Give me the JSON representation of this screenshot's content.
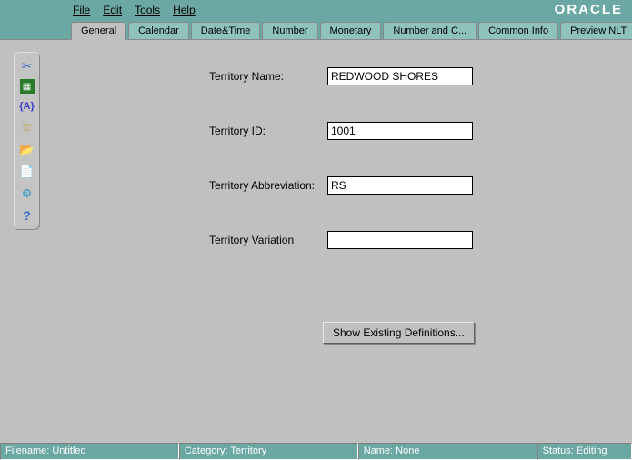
{
  "brand": "ORACLE",
  "menu": {
    "file": "File",
    "edit": "Edit",
    "tools": "Tools",
    "help": "Help"
  },
  "tabs": {
    "general": "General",
    "calendar": "Calendar",
    "datetime": "Date&Time",
    "number": "Number",
    "monetary": "Monetary",
    "numberc": "Number and C...",
    "common": "Common Info",
    "preview": "Preview NLT"
  },
  "form": {
    "territory_name_label": "Territory Name:",
    "territory_name_value": "REDWOOD SHORES",
    "territory_id_label": "Territory ID:",
    "territory_id_value": "1001",
    "territory_abbr_label": "Territory Abbreviation:",
    "territory_abbr_value": "RS",
    "territory_var_label": "Territory Variation",
    "territory_var_value": "",
    "show_button": "Show Existing Definitions..."
  },
  "status": {
    "filename": "Filename: Untitled",
    "category": "Category: Territory",
    "name": "Name: None",
    "state": "Status: Editing"
  }
}
